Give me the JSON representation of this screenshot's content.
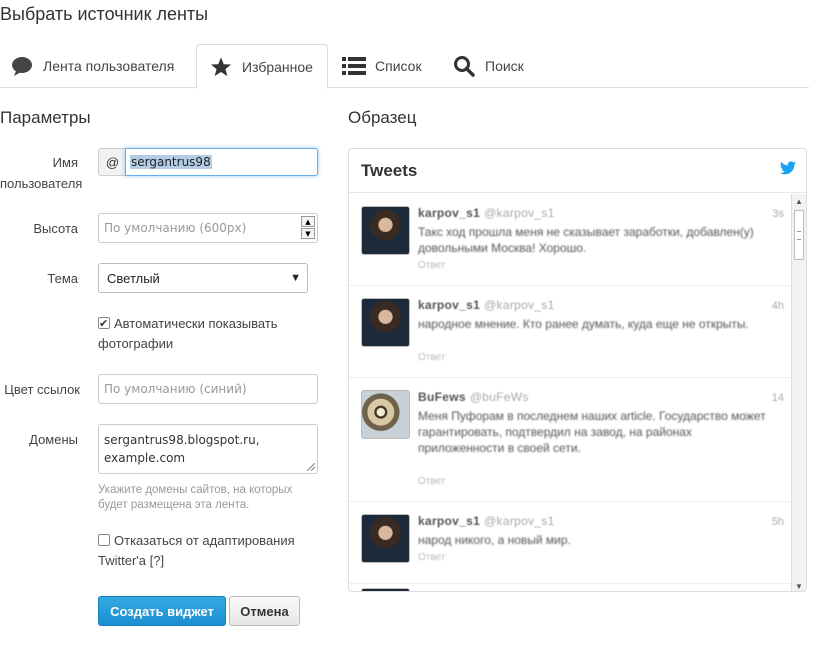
{
  "page": {
    "title": "Выбрать источник ленты"
  },
  "tabs": [
    {
      "label": "Лента пользователя",
      "icon": "speech-bubble-icon"
    },
    {
      "label": "Избранное",
      "icon": "star-icon",
      "active": true
    },
    {
      "label": "Список",
      "icon": "list-icon"
    },
    {
      "label": "Поиск",
      "icon": "magnifier-icon"
    }
  ],
  "params": {
    "title": "Параметры",
    "username": {
      "label_line1": "Имя",
      "label_line2": "пользователя",
      "prefix": "@",
      "value": "sergantrus98"
    },
    "height": {
      "label": "Высота",
      "placeholder": "По умолчанию (600px)"
    },
    "theme": {
      "label": "Тема",
      "value": "Светлый"
    },
    "auto_photos": {
      "line1": "Автоматически показывать",
      "line2": "фотографии",
      "checked": true
    },
    "link_color": {
      "label": "Цвет ссылок",
      "placeholder": "По умолчанию (синий)"
    },
    "domains": {
      "label": "Домены",
      "value_line1": "sergantrus98.blogspot.ru,",
      "value_line2": "example.com",
      "hint": "Укажите домены сайтов, на которых будет размещена эта лента."
    },
    "opt_out": {
      "line1": "Отказаться от адаптирования",
      "line2": "Twitter'а [?]",
      "checked": false
    },
    "create_button": "Создать виджет",
    "cancel_button": "Отмена"
  },
  "preview": {
    "title": "Образец",
    "widget_title": "Tweets",
    "colors": {
      "twitter_blue": "#1da1f2",
      "primary_button": "#1b8fd1"
    }
  }
}
